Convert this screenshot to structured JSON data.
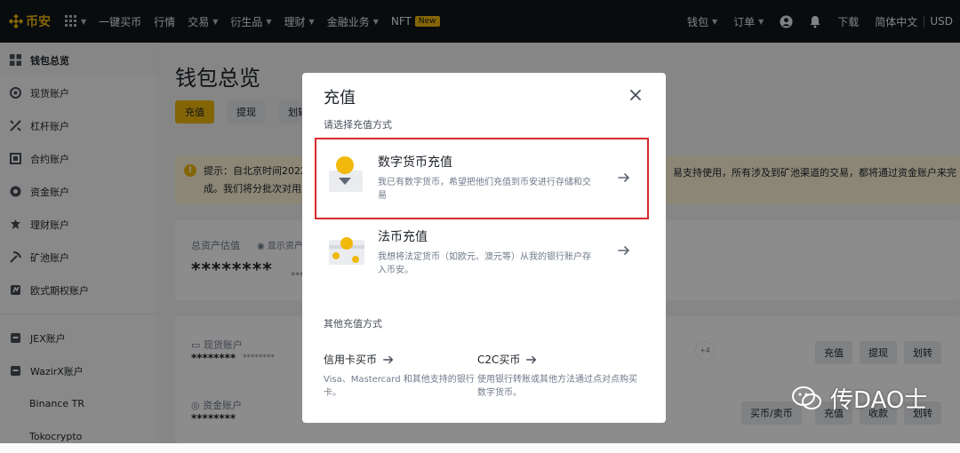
{
  "topbar": {
    "logo_text": "币安",
    "nav": [
      "一键买币",
      "行情",
      "交易",
      "衍生品",
      "理财",
      "金融业务",
      "NFT"
    ],
    "new_badge": "New",
    "right": [
      "钱包",
      "订单",
      "下载",
      "简体中文",
      "USD"
    ]
  },
  "sidebar": {
    "items": [
      "钱包总览",
      "现货账户",
      "杠杆账户",
      "合约账户",
      "资金账户",
      "理财账户",
      "矿池账户",
      "欧式期权账户"
    ],
    "extra_items": [
      "JEX账户",
      "WazirX账户",
      "Binance TR",
      "Tokocrypto"
    ]
  },
  "main": {
    "title": "钱包总览",
    "buttons": [
      "充值",
      "提现",
      "划转"
    ],
    "notice_left": "提示：自北京时间2022",
    "notice_left2": "成。我们将分批次对用户",
    "notice_right": "易支持使用，所有涉及到矿池渠道的交易，都将通过资金账户来完",
    "total_label": "总资产估值",
    "show_assets": "显示资产",
    "total_stars": "********",
    "total_stars_small": "********",
    "spot_label": "现货账户",
    "spot_stars": "********",
    "spot_stars_small": "********",
    "funding_label": "资金账户",
    "funding_stars": "********",
    "plus_count": "+4",
    "spot_buttons": [
      "充值",
      "提现",
      "划转"
    ],
    "funding_buttons": [
      "买币/卖币",
      "充值",
      "收款",
      "划转"
    ]
  },
  "modal": {
    "title": "充值",
    "subtitle": "请选择充值方式",
    "option1_title": "数字货币充值",
    "option1_desc": "我已有数字货币，希望把他们充值到币安进行存储和交易",
    "option2_title": "法币充值",
    "option2_desc": "我想将法定货币（如欧元、澳元等）从我的银行账户存入币安。",
    "other_label": "其他充值方式",
    "card_title": "信用卡买币",
    "card_desc": "Visa、Mastercard 和其他支持的银行卡。",
    "c2c_title": "C2C买币",
    "c2c_desc": "使用银行转账或其他方法通过点对点购买数字货币。"
  },
  "watermark": "传DAO士",
  "colors": {
    "brand": "#f0b90b",
    "highlight": "#d9292c",
    "topbar": "#12161c"
  }
}
